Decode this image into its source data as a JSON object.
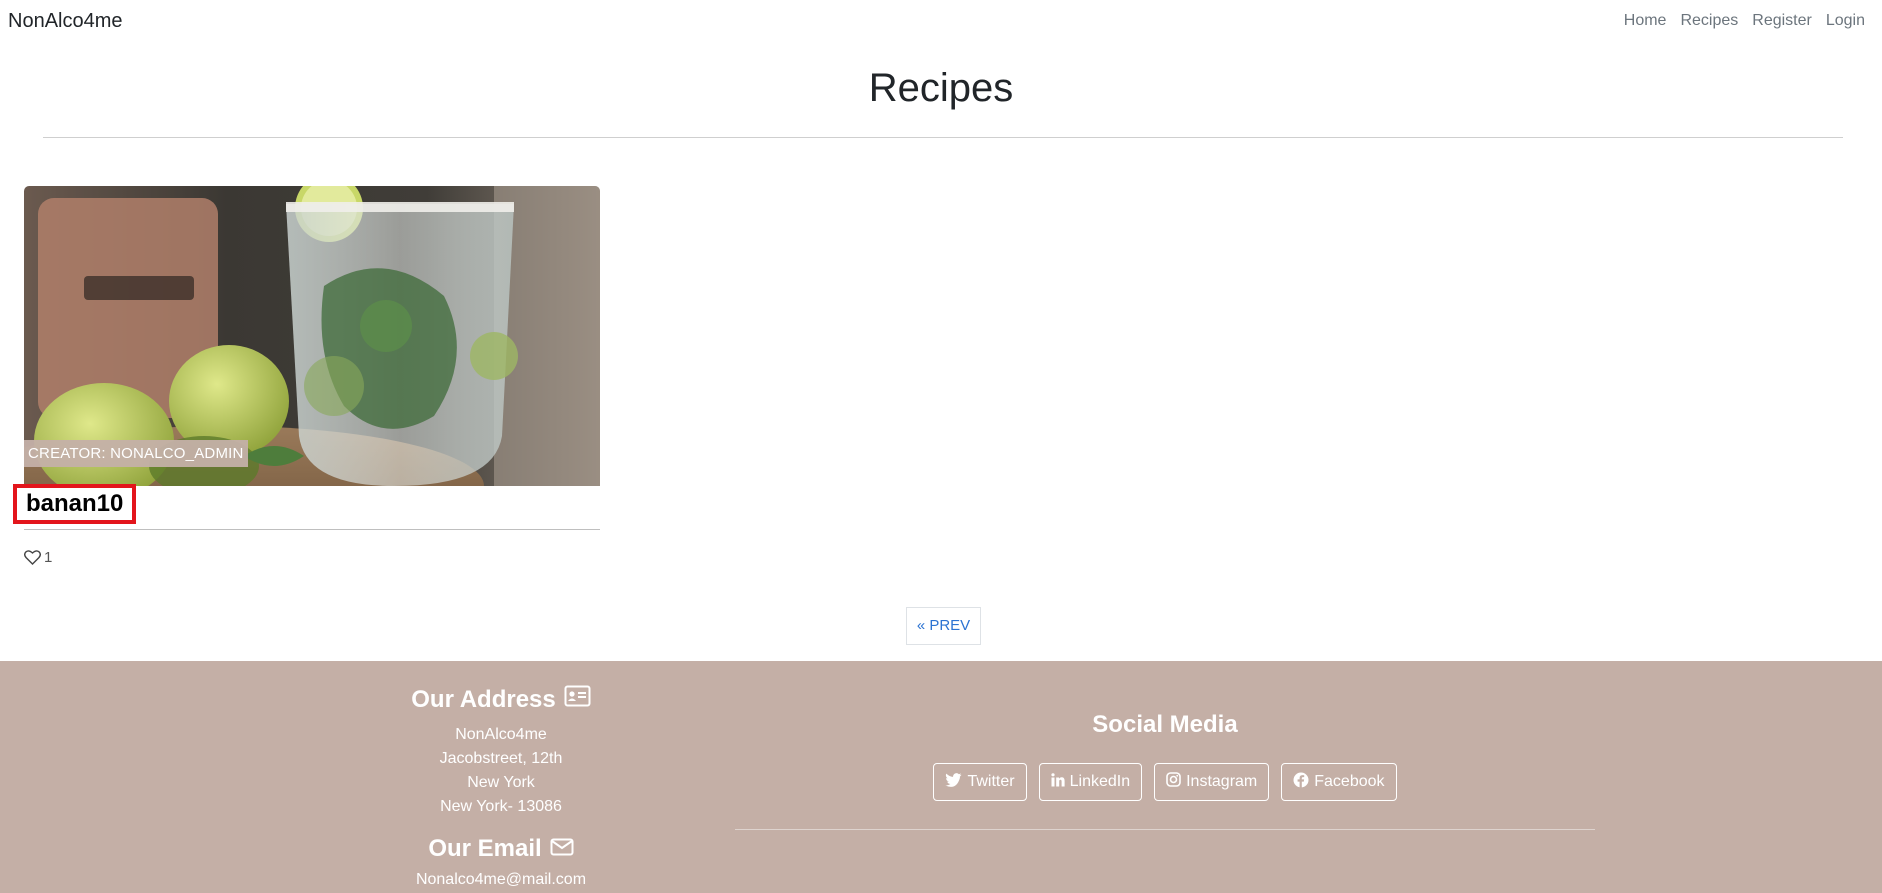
{
  "navbar": {
    "brand": "NonAlco4me",
    "links": [
      "Home",
      "Recipes",
      "Register",
      "Login"
    ]
  },
  "page": {
    "title": "Recipes"
  },
  "recipe_card": {
    "creator": "CREATOR: NONALCO_ADMIN",
    "title": "banan10",
    "likes": "1",
    "image_alt": "mojito-glass-with-limes"
  },
  "pagination": {
    "prev_label": "« PREV"
  },
  "footer": {
    "address_heading": "Our Address",
    "address_lines": [
      "NonAlco4me",
      "Jacobstreet, 12th",
      "New York",
      "New York- 13086"
    ],
    "email_heading": "Our Email",
    "email": "Nonalco4me@mail.com",
    "social_heading": "Social Media",
    "social_buttons": [
      "Twitter",
      "LinkedIn",
      "Instagram",
      "Facebook"
    ]
  },
  "colors": {
    "footer_bg": "#c4afa6",
    "link_blue": "#2c73d2",
    "highlight_red": "#e3151c"
  }
}
